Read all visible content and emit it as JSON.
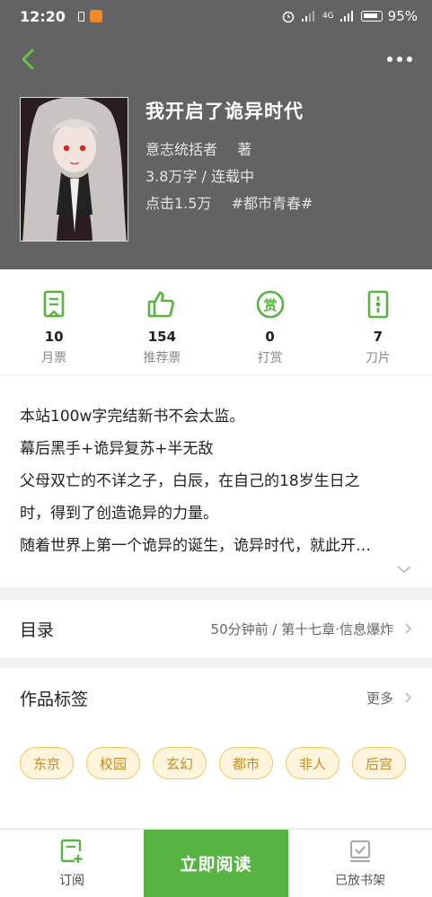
{
  "status_bar": {
    "time": "12:20",
    "network": "4G",
    "battery": "95%"
  },
  "book": {
    "title": "我开启了诡异时代",
    "author": "意志统括者",
    "author_suffix": "著",
    "word_count": "3.8万字",
    "status": "连载中",
    "clicks": "点击1.5万",
    "category": "#都市青春#"
  },
  "stats": [
    {
      "icon": "monthly-ticket-icon",
      "value": "10",
      "label": "月票"
    },
    {
      "icon": "thumbs-up-icon",
      "value": "154",
      "label": "推荐票"
    },
    {
      "icon": "reward-icon",
      "value": "0",
      "label": "打赏"
    },
    {
      "icon": "blade-icon",
      "value": "7",
      "label": "刀片"
    }
  ],
  "description": {
    "lines": [
      "本站100w字完结新书不会太监。",
      "幕后黑手+诡异复苏+半无敌",
      "父母双亡的不详之子，白辰，在自己的18岁生日之",
      "时，得到了创造诡异的力量。",
      "随着世界上第一个诡异的诞生，诡异时代，就此开…"
    ]
  },
  "catalog": {
    "title": "目录",
    "latest": "50分钟前 / 第十七章·信息爆炸"
  },
  "tags": {
    "title": "作品标签",
    "more": "更多",
    "items": [
      "东京",
      "校园",
      "玄幻",
      "都市",
      "非人",
      "后宫"
    ]
  },
  "bottom_bar": {
    "subscribe": "订阅",
    "read_now": "立即阅读",
    "on_shelf": "已放书架"
  },
  "colors": {
    "header_bg": "#636363",
    "accent_green": "#58b442",
    "tag_text": "#c98a1d",
    "tag_bg": "#fff5dc"
  }
}
